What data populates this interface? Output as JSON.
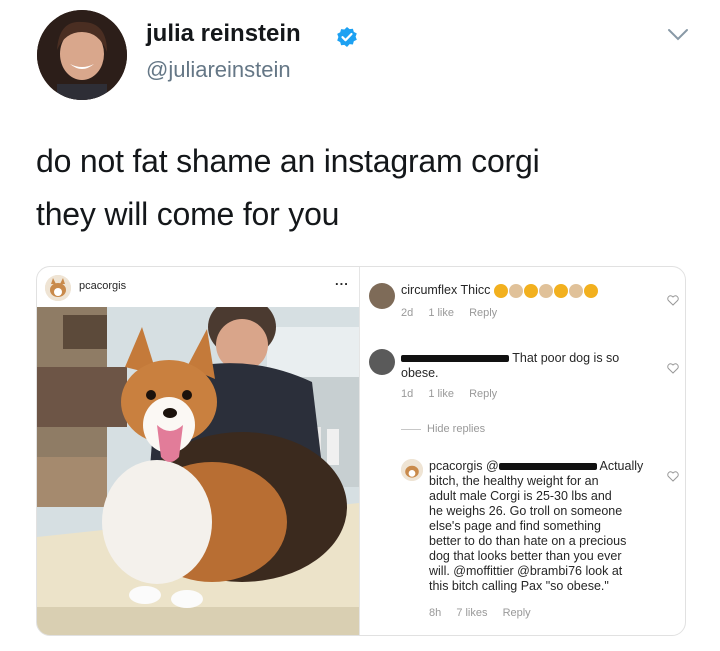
{
  "tweet": {
    "display_name": "julia reinstein",
    "handle": "@juliareinstein",
    "text_line1": "do not fat shame an instagram corgi",
    "text_line2": "they will come for you"
  },
  "instagram": {
    "post_username": "pcacorgis",
    "more_glyph": "...",
    "comments": [
      {
        "username": "circumflex",
        "text": "Thicc",
        "time": "2d",
        "likes": "1 like",
        "reply": "Reply"
      },
      {
        "text_line1": "That poor dog is so",
        "text_line2": "obese.",
        "time": "1d",
        "likes": "1 like",
        "reply": "Reply"
      }
    ],
    "hide_replies": "Hide replies",
    "reply_comment": {
      "username": "pcacorgis",
      "mention_prefix": "@",
      "first_word": "Actually",
      "lines": [
        "bitch, the healthy weight for an",
        "adult male Corgi is 25-30 lbs and",
        "he weighs 26. Go troll on someone",
        "else's page and find something",
        "better to do than hate on a precious",
        "dog that looks better than you ever",
        "will. @moffittier @brambi76 look at",
        "this bitch calling Pax \"so obese.\""
      ],
      "time": "8h",
      "likes": "7 likes",
      "reply": "Reply"
    }
  },
  "icons": {
    "verified": "verified-badge-icon",
    "chevron": "chevron-down-icon",
    "heart": "heart-icon"
  },
  "colors": {
    "verified_blue": "#1da1f2",
    "handle_gray": "#657786",
    "ig_meta_gray": "#999999"
  }
}
